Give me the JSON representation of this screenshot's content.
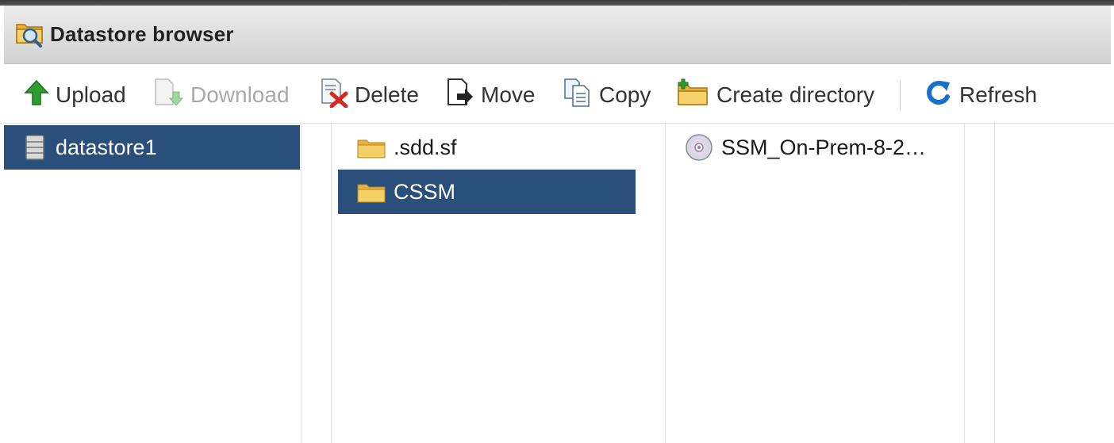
{
  "window": {
    "title": "Datastore browser"
  },
  "toolbar": {
    "upload": "Upload",
    "download": "Download",
    "delete": "Delete",
    "move": "Move",
    "copy": "Copy",
    "create_directory": "Create directory",
    "refresh": "Refresh"
  },
  "panes": {
    "datastores": [
      {
        "label": "datastore1",
        "icon": "database-icon",
        "selected": true
      }
    ],
    "folders": [
      {
        "label": ".sdd.sf",
        "icon": "folder-icon",
        "selected": false
      },
      {
        "label": "CSSM",
        "icon": "folder-icon",
        "selected": true
      }
    ],
    "files": [
      {
        "label": "SSM_On-Prem-8-2…",
        "icon": "disc-image-icon",
        "selected": false
      }
    ]
  },
  "colors": {
    "selection": "#2a4f7a",
    "disabled_text": "#a9a9a9",
    "upload_green": "#2e9e2e",
    "refresh_blue": "#1a6fc9",
    "delete_red": "#d8281e",
    "folder_yellow": "#f2c84b"
  }
}
